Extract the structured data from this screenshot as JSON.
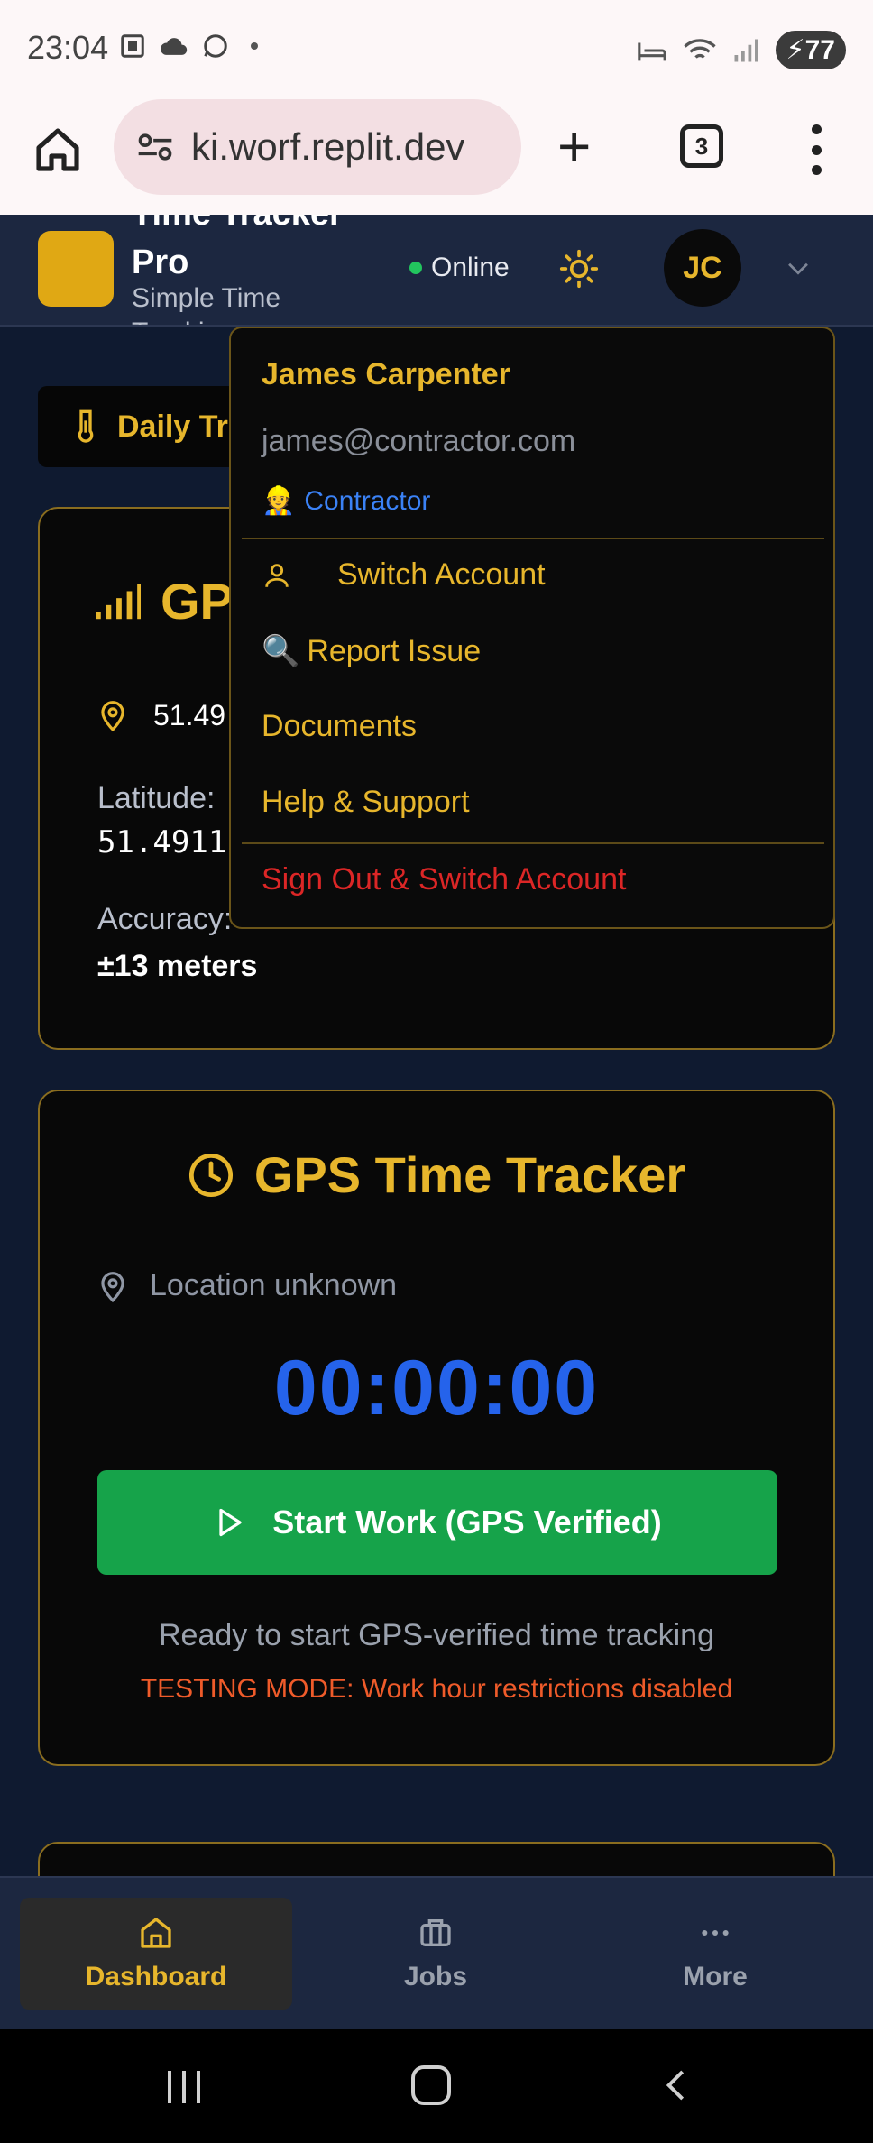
{
  "status_bar": {
    "time": "23:04",
    "battery": "77"
  },
  "browser": {
    "url": "ki.worf.replit.dev",
    "tab_count": "3"
  },
  "header": {
    "brand_title_line1": "Time Tracker",
    "brand_title_line2": "Pro",
    "brand_sub_line1": "Simple Time",
    "brand_sub_line2": "Tracking",
    "online_label": "Online",
    "avatar_initials": "JC"
  },
  "daily_tab_label": "Daily Tr",
  "gps_card": {
    "title": "GP",
    "coordinates": "51.49",
    "latitude_label": "Latitude:",
    "latitude_value": "51.4911",
    "accuracy_label": "Accuracy:",
    "accuracy_value": "±13 meters"
  },
  "tracker_card": {
    "title": "GPS Time Tracker",
    "location": "Location unknown",
    "timer": "00:00:00",
    "start_button": "Start Work (GPS Verified)",
    "ready_text": "Ready to start GPS-verified time tracking",
    "testing_text": "TESTING MODE: Work hour restrictions disabled"
  },
  "dropdown": {
    "name": "James Carpenter",
    "email": "james@contractor.com",
    "role_emoji": "👷",
    "role": "Contractor",
    "items": {
      "switch_account": "Switch Account",
      "report_emoji": "🔍",
      "report_issue": "Report Issue",
      "documents": "Documents",
      "help": "Help & Support",
      "sign_out": "Sign Out & Switch Account"
    }
  },
  "bottom_nav": {
    "dashboard": "Dashboard",
    "jobs": "Jobs",
    "more": "More"
  },
  "colors": {
    "accent": "#e7b62c",
    "timer": "#2563eb",
    "start": "#16a34a",
    "danger": "#dc2626"
  }
}
